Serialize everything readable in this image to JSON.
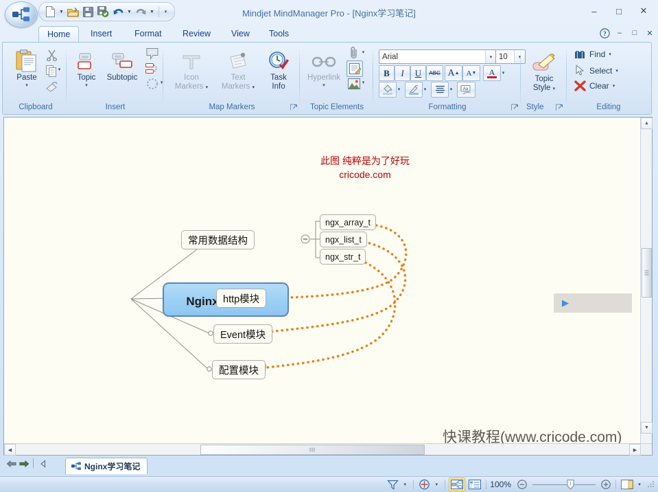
{
  "window": {
    "title": "Mindjet MindManager Pro - [Nginx学习笔记]",
    "minimize": "–",
    "restore": "□",
    "close": "✕"
  },
  "quick_access": {
    "items": [
      {
        "name": "new-document-icon",
        "tooltip": "New"
      },
      {
        "name": "open-document-icon",
        "tooltip": "Open"
      },
      {
        "name": "save-icon",
        "tooltip": "Save"
      },
      {
        "name": "save-and-publish-icon",
        "tooltip": "Save & Send"
      },
      {
        "name": "undo-icon",
        "tooltip": "Undo"
      },
      {
        "name": "redo-icon",
        "tooltip": "Redo"
      }
    ],
    "customize_label": "▾"
  },
  "ribbon_window_controls": {
    "help": "?",
    "minimize": "–",
    "restore": "□",
    "close": "✕"
  },
  "tabs": [
    {
      "label": "Home",
      "active": true
    },
    {
      "label": "Insert",
      "active": false
    },
    {
      "label": "Format",
      "active": false
    },
    {
      "label": "Review",
      "active": false
    },
    {
      "label": "View",
      "active": false
    },
    {
      "label": "Tools",
      "active": false
    }
  ],
  "ribbon": {
    "groups": [
      {
        "name": "clipboard",
        "label": "Clipboard"
      },
      {
        "name": "insert",
        "label": "Insert"
      },
      {
        "name": "map-markers",
        "label": "Map Markers"
      },
      {
        "name": "topic-elements",
        "label": "Topic Elements"
      },
      {
        "name": "formatting",
        "label": "Formatting"
      },
      {
        "name": "style",
        "label": "Style"
      },
      {
        "name": "editing",
        "label": "Editing"
      }
    ],
    "clipboard": {
      "paste_label": "Paste",
      "paste_caret": "▾",
      "cut_name": "cut-icon",
      "copy_name": "copy-icon",
      "copy_caret": "▾",
      "format_painter_name": "format-painter-icon"
    },
    "insert": {
      "topic_label": "Topic",
      "topic_caret": "▾",
      "subtopic_label": "Subtopic",
      "callout_name": "callout-topic-icon",
      "relationship_name": "relationship-icon",
      "boundary_name": "boundary-icon",
      "boundary_caret": "▾"
    },
    "map_markers": {
      "icon_markers_label": "Icon\nMarkers",
      "icon_markers_line1": "Icon",
      "icon_markers_line2": "Markers",
      "icon_markers_caret": "▾",
      "icon_markers_disabled": true,
      "text_markers_line1": "Text",
      "text_markers_line2": "Markers",
      "text_markers_caret": "▾",
      "text_markers_disabled": true,
      "task_info_line1": "Task",
      "task_info_line2": "Info",
      "task_info_disabled": false,
      "dialog_launcher": "dialog-launcher-icon"
    },
    "topic_elements": {
      "hyperlink_label": "Hyperlink",
      "hyperlink_caret": "▾",
      "hyperlink_disabled": true,
      "attachment_name": "attachment-icon",
      "attachment_caret": "▾",
      "notes_name": "notes-icon",
      "image_name": "image-icon",
      "image_caret": "▾"
    },
    "formatting": {
      "font_name": "Arial",
      "font_caret": "▾",
      "font_size": "10",
      "font_size_caret": "▾",
      "bold": "B",
      "italic": "I",
      "underline": "U",
      "strikethrough": "ABC",
      "grow_font": "A",
      "shrink_font": "A",
      "font_color": "A",
      "font_color_caret": "▾",
      "fill_color_name": "fill-color-icon",
      "fill_caret": "▾",
      "line_color_name": "line-color-icon",
      "line_caret": "▾",
      "align_name": "align-icon",
      "align_caret": "▾",
      "clear_format_name": "clear-formatting-icon",
      "dialog_launcher": "dialog-launcher-icon"
    },
    "style": {
      "topic_style_line1": "Topic",
      "topic_style_line2": "Style",
      "topic_style_caret": "▾",
      "dialog_launcher": "dialog-launcher-icon"
    },
    "editing": {
      "find_label": "Find",
      "find_caret": "▾",
      "select_label": "Select",
      "select_caret": "▾",
      "clear_label": "Clear",
      "clear_caret": "▾"
    }
  },
  "map": {
    "annotation_line1": "此图 纯粹是为了好玩",
    "annotation_line2": "cricode.com",
    "watermark": "快课教程(www.cricode.com)",
    "central_topic": "Nginx学习笔记",
    "branches": [
      {
        "label": "常用数据结构",
        "collapse_toggle": "–"
      },
      {
        "label": "http模块"
      },
      {
        "label": "Event模块"
      },
      {
        "label": "配置模块"
      }
    ],
    "subtopics": [
      {
        "label": "ngx_array_t"
      },
      {
        "label": "ngx_list_t"
      },
      {
        "label": "ngx_str_t"
      }
    ],
    "task_pane_toggle": "▶",
    "colors": {
      "central_fill": "#9fd2f4",
      "central_border": "#6b93bd",
      "canvas": "#fdfdf3",
      "relationship_line": "#e8801a",
      "annotation_text": "#c00000"
    }
  },
  "scrollbars": {
    "up": "▲",
    "down": "▼",
    "left": "◀",
    "right": "▶"
  },
  "document_tabs": {
    "back": "⬅",
    "forward": "➡",
    "prev": "◁",
    "tabs": [
      {
        "label": "Nginx学习笔记",
        "icon": "map-document-icon",
        "active": true
      }
    ]
  },
  "status_bar": {
    "filter_name": "filter-icon",
    "filter_caret": "▾",
    "refresh_name": "rollup-icon",
    "refresh_caret": "▾",
    "map_view_name": "map-view-icon",
    "outline_view_name": "outline-view-icon",
    "zoom_level": "100%",
    "zoom_out": "–",
    "zoom_in": "+",
    "pane_toggle_name": "task-pane-toggle-icon",
    "pane_caret": "▾",
    "resize_grip_name": "resize-grip"
  }
}
